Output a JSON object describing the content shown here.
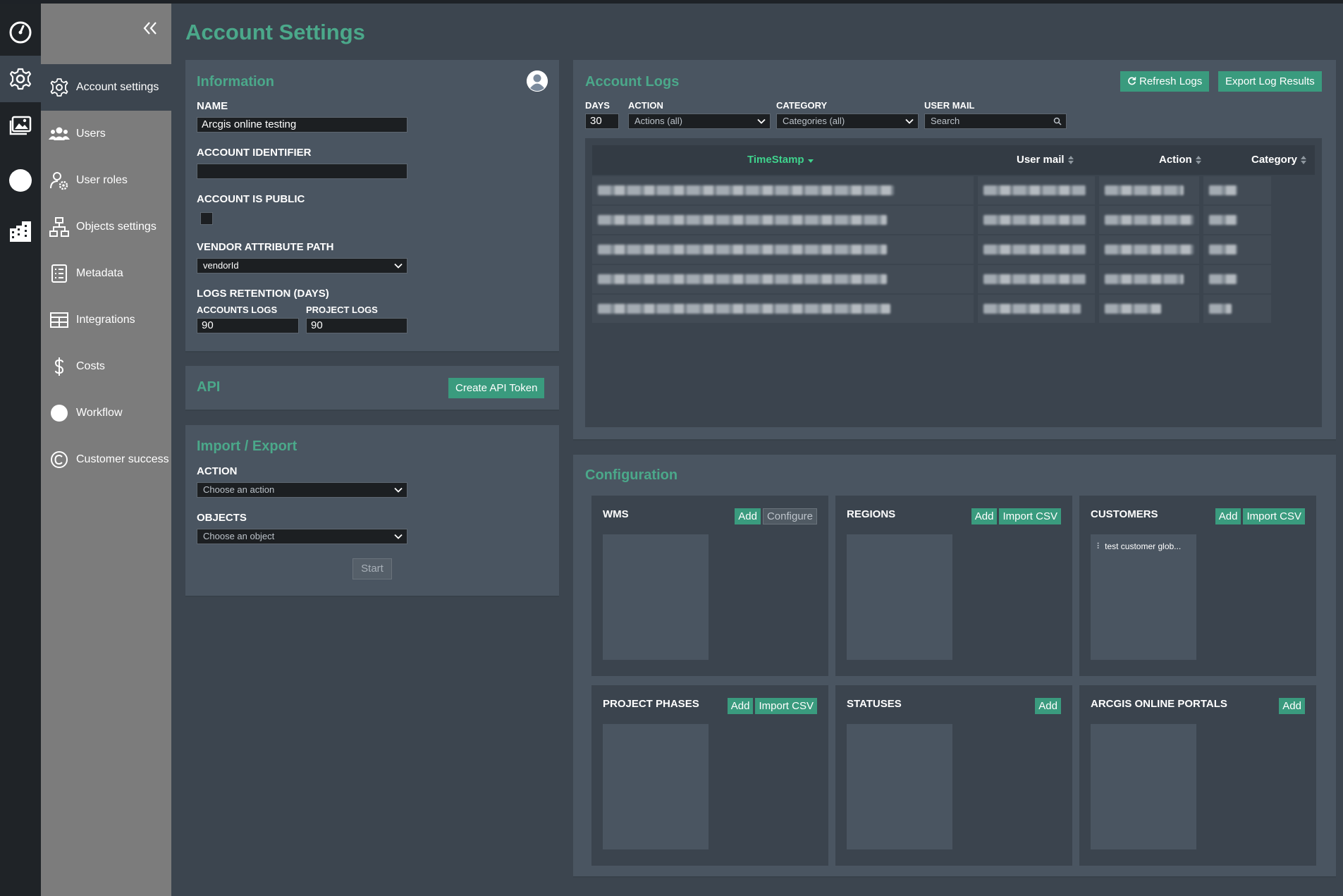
{
  "page": {
    "title": "Account Settings"
  },
  "colors": {
    "accent": "#4ba88a",
    "button": "#3a9b7e",
    "sorted_header": "#3fd38d",
    "panel": "#4a5561",
    "background": "#3c454f"
  },
  "rail": {
    "items": [
      {
        "icon": "dashboard-icon"
      },
      {
        "icon": "gear-icon",
        "active": true
      },
      {
        "icon": "image-gallery-icon"
      },
      {
        "icon": "circle-icon"
      },
      {
        "icon": "buildings-icon"
      }
    ]
  },
  "sidebar": {
    "collapse_icon": "double-chevron-left-icon",
    "items": [
      {
        "label": "Account settings",
        "icon": "gear-icon",
        "active": true
      },
      {
        "label": "Users",
        "icon": "users-icon"
      },
      {
        "label": "User roles",
        "icon": "user-gear-icon"
      },
      {
        "label": "Objects settings",
        "icon": "hierarchy-icon"
      },
      {
        "label": "Metadata",
        "icon": "list-icon"
      },
      {
        "label": "Integrations",
        "icon": "table-icon"
      },
      {
        "label": "Costs",
        "icon": "dollar-icon"
      },
      {
        "label": "Workflow",
        "icon": "circle-icon"
      },
      {
        "label": "Customer success",
        "icon": "copyright-icon"
      }
    ]
  },
  "information": {
    "title": "Information",
    "avatar_icon": "user-avatar-icon",
    "name_label": "NAME",
    "name_value": "Arcgis online testing",
    "identifier_label": "ACCOUNT IDENTIFIER",
    "identifier_value": "",
    "public_label": "ACCOUNT IS PUBLIC",
    "public_checked": false,
    "vendor_label": "VENDOR ATTRIBUTE PATH",
    "vendor_value": "vendorId",
    "retention_label": "LOGS RETENTION (DAYS)",
    "accounts_logs_label": "ACCOUNTS LOGS",
    "accounts_logs_value": "90",
    "project_logs_label": "PROJECT LOGS",
    "project_logs_value": "90"
  },
  "api": {
    "title": "API",
    "create_token_label": "Create API Token"
  },
  "import_export": {
    "title": "Import / Export",
    "action_label": "ACTION",
    "action_placeholder": "Choose an action",
    "objects_label": "OBJECTS",
    "objects_placeholder": "Choose an object",
    "start_label": "Start"
  },
  "account_logs": {
    "title": "Account Logs",
    "refresh_label": "Refresh Logs",
    "refresh_icon": "refresh-icon",
    "export_label": "Export Log Results",
    "filters": {
      "days_label": "DAYS",
      "days_value": "30",
      "action_label": "ACTION",
      "action_value": "Actions (all)",
      "category_label": "CATEGORY",
      "category_value": "Categories (all)",
      "user_mail_label": "USER MAIL",
      "search_placeholder": "Search",
      "search_icon": "search-icon"
    },
    "columns": [
      "TimeStamp",
      "User mail",
      "Action",
      "Category"
    ],
    "sorted_column": "TimeStamp",
    "sort_direction": "descending",
    "row_count": 5,
    "rows_redacted": true
  },
  "configuration": {
    "title": "Configuration",
    "cards": [
      {
        "title": "WMS",
        "buttons": [
          "Add",
          "Configure"
        ],
        "items": []
      },
      {
        "title": "REGIONS",
        "buttons": [
          "Add",
          "Import CSV"
        ],
        "items": []
      },
      {
        "title": "CUSTOMERS",
        "buttons": [
          "Add",
          "Import CSV"
        ],
        "items": [
          "test customer glob..."
        ]
      },
      {
        "title": "PROJECT PHASES",
        "buttons": [
          "Add",
          "Import CSV"
        ],
        "items": []
      },
      {
        "title": "STATUSES",
        "buttons": [
          "Add"
        ],
        "items": []
      },
      {
        "title": "ARCGIS ONLINE PORTALS",
        "buttons": [
          "Add"
        ],
        "items": []
      }
    ]
  }
}
